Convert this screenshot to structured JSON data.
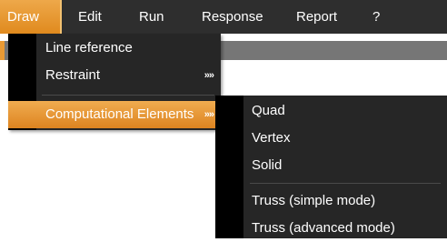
{
  "menubar": {
    "items": [
      {
        "label": "Draw"
      },
      {
        "label": "Edit"
      },
      {
        "label": "Run"
      },
      {
        "label": "Response"
      },
      {
        "label": "Report"
      },
      {
        "label": "?"
      }
    ]
  },
  "draw_menu": {
    "items": [
      {
        "label": "Line reference"
      },
      {
        "label": "Restraint",
        "arrow": "»»"
      },
      {
        "label": "Computational Elements",
        "arrow": "»»"
      }
    ]
  },
  "computational_submenu": {
    "items": [
      {
        "label": "Quad"
      },
      {
        "label": "Vertex"
      },
      {
        "label": "Solid"
      },
      {
        "label": "Truss (simple mode)"
      },
      {
        "label": "Truss (advanced mode)"
      }
    ]
  },
  "colors": {
    "menubar_bg": "#2e2e2e",
    "menu_bg": "#262626",
    "gutter": "#000000",
    "accent": "#e99a34"
  }
}
